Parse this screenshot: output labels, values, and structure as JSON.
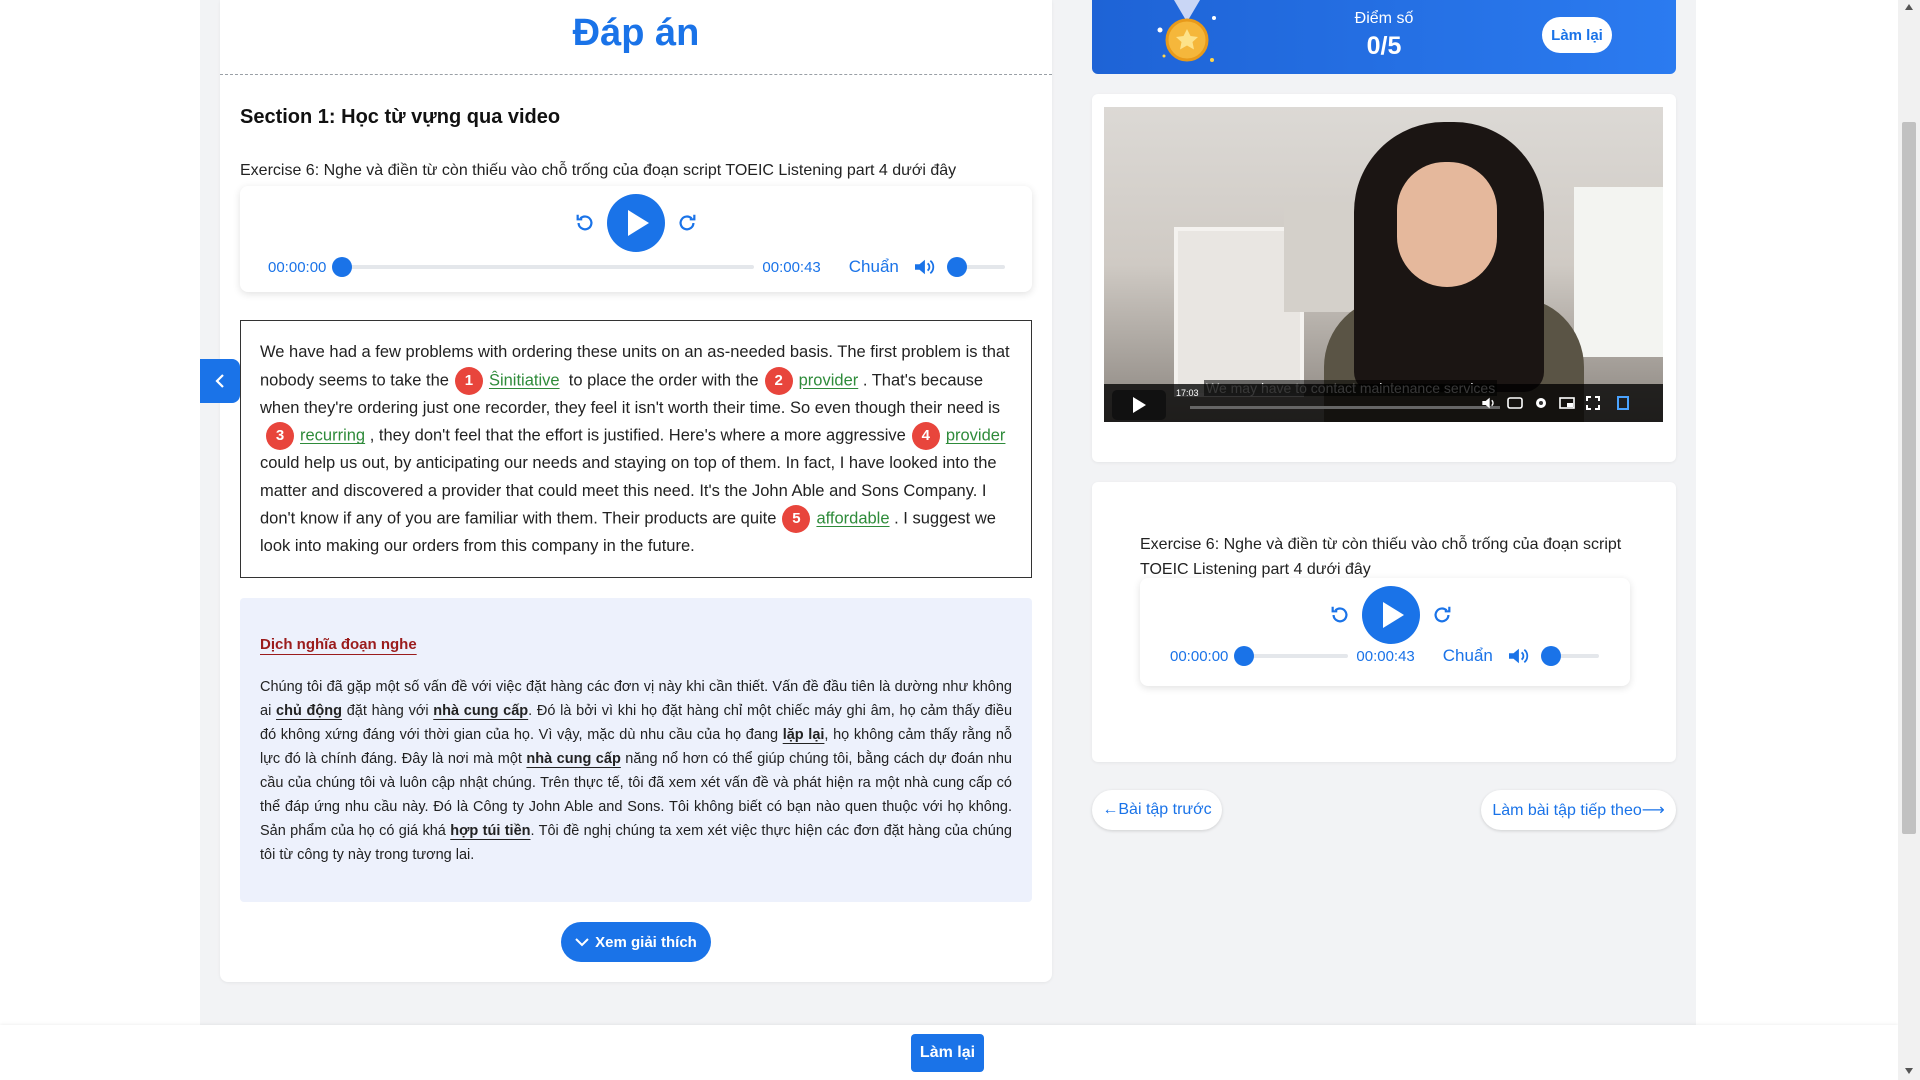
{
  "page": {
    "title": "Đáp án",
    "section_title": "Section 1: Học từ vựng qua video",
    "exercise_instruction": "Exercise 6: Nghe và điền từ còn thiếu vào chỗ trống của đoạn script TOEIC Listening part 4 dưới đây"
  },
  "audio_player": {
    "current_time": "00:00:00",
    "duration": "00:00:43",
    "speed_label": "Chuẩn",
    "progress_fraction": 0,
    "volume_fraction": 0
  },
  "passage": {
    "p1": "We have had a few problems with ordering these units on an as-needed basis. The first problem is that nobody seems to take the",
    "n1": "1",
    "a1": "Ŝinitiative",
    "p2": "to place the order with the",
    "n2": "2",
    "a2": "provider",
    "p3": ". That's because when they're ordering just one recorder, they feel it isn't worth their time. So even though their need is",
    "n3": "3",
    "a3": "recurring",
    "p4": ", they don't feel that the effort is justified. Here's where a more aggressive",
    "n4": "4",
    "a4": "provider",
    "p5": "could help us out, by anticipating our needs and staying on top of them. In fact, I have looked into the matter and discovered a provider that could meet this need. It's the John Able and Sons Company. I don't know if any of you are familiar with them. Their products are quite",
    "n5": "5",
    "a5": "affordable",
    "p6": ". I suggest we look into making our orders from this company in the future."
  },
  "translation": {
    "title": "Dịch nghĩa đoạn nghe",
    "t1": "Chúng tôi đã gặp một số vấn đề với việc đặt hàng các đơn vị này khi cần thiết. Vấn đề đầu tiên là dường như không ai",
    "b1": "chủ động",
    "t2": "đặt hàng với",
    "b2": "nhà cung cấp",
    "t3": ". Đó là bởi vì khi họ đặt hàng chỉ một chiếc máy ghi âm, họ cảm thấy điều đó không xứng đáng với thời gian của họ. Vì vậy, mặc dù nhu cầu của họ đang",
    "b3": "lặp lại",
    "t4": ", họ không cảm thấy rằng nỗ lực đó là chính đáng. Đây là nơi mà một",
    "b4": "nhà cung cấp",
    "t5": "năng nổ hơn có thể giúp chúng tôi, bằng cách dự đoán nhu cầu của chúng tôi và luôn cập nhật chúng. Trên thực tế, tôi đã xem xét vấn đề và phát hiện ra một nhà cung cấp có thể đáp ứng nhu cầu này. Đó là Công ty John Able and Sons. Tôi không biết có bạn nào quen thuộc với họ không. Sản phẩm của họ có giá khá",
    "b5": "hợp túi tiền",
    "t6": ". Tôi đề nghị chúng ta xem xét việc thực hiện các đơn đặt hàng của chúng tôi từ công ty này trong tương lai."
  },
  "buttons": {
    "explain": "Xem giải thích",
    "redo_small": "Làm lại",
    "redo_main": "Làm lại",
    "prev": "←Bài tập trước",
    "next": "Làm bài tập tiếp theo⟶"
  },
  "score": {
    "label": "Điểm số",
    "value": "0/5"
  },
  "video": {
    "timestamp": "17:03",
    "caption": "We may have to contact maintenance services"
  },
  "right_exercise": {
    "instruction": "Exercise 6: Nghe và điền từ còn thiếu vào chỗ trống của đoạn script TOEIC Listening part 4 dưới đây"
  },
  "colors": {
    "accent": "#1a73e8",
    "answer": "#2e8b3a",
    "number_badge": "#e8453c",
    "translation_title": "#9b1c1c"
  }
}
